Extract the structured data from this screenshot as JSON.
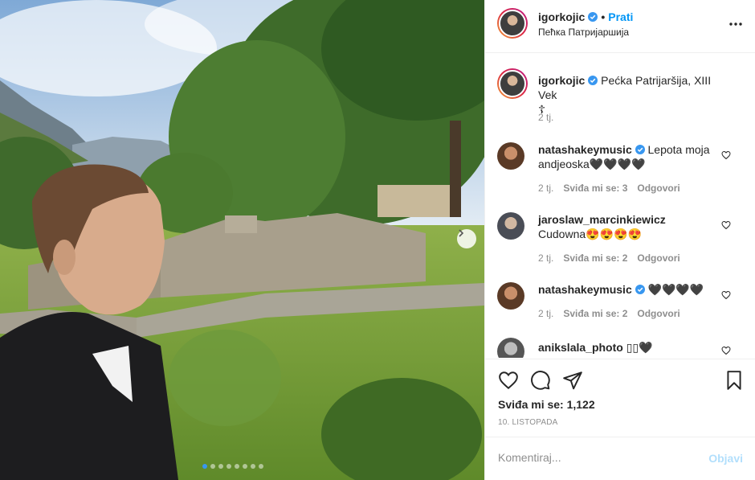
{
  "post": {
    "username": "igorkojic",
    "follow_label": "Prati",
    "separator": "•",
    "location": "Пећка Патријаршија",
    "caption_user": "igorkojic",
    "caption_text": "Pećka Patrijaršija, XIII Vek",
    "caption_line2": "☦",
    "caption_time": "2 tj.",
    "likes": "Sviđa mi se: 1,122",
    "date": "10. LISTOPADA",
    "comment_placeholder": "Komentiraj...",
    "post_label": "Objavi",
    "carousel_index": 0,
    "carousel_count": 8
  },
  "comments": [
    {
      "user": "natashakeymusic",
      "verified": true,
      "text": "Lepota moja andjeoska🖤🖤🖤🖤",
      "time": "2 tj.",
      "likes": "Sviđa mi se: 3",
      "reply": "Odgovori"
    },
    {
      "user": "jaroslaw_marcinkiewicz",
      "verified": false,
      "text": "Cudowna😍😍😍😍",
      "time": "2 tj.",
      "likes": "Sviđa mi se: 2",
      "reply": "Odgovori"
    },
    {
      "user": "natashakeymusic",
      "verified": true,
      "text": "🖤🖤🖤🖤",
      "time": "2 tj.",
      "likes": "Sviđa mi se: 2",
      "reply": "Odgovori"
    },
    {
      "user": "anikslala_photo",
      "verified": false,
      "text": "▯▯🖤",
      "time": "",
      "likes": "",
      "reply": ""
    }
  ],
  "colors": {
    "accent": "#0095f6",
    "verified": "#3897f0",
    "muted": "#8e8e8e",
    "post_disabled": "#b2dffc"
  },
  "icons": [
    "verified-badge-icon",
    "more-options-icon",
    "heart-icon",
    "comment-icon",
    "share-icon",
    "bookmark-icon",
    "chevron-right-icon"
  ]
}
